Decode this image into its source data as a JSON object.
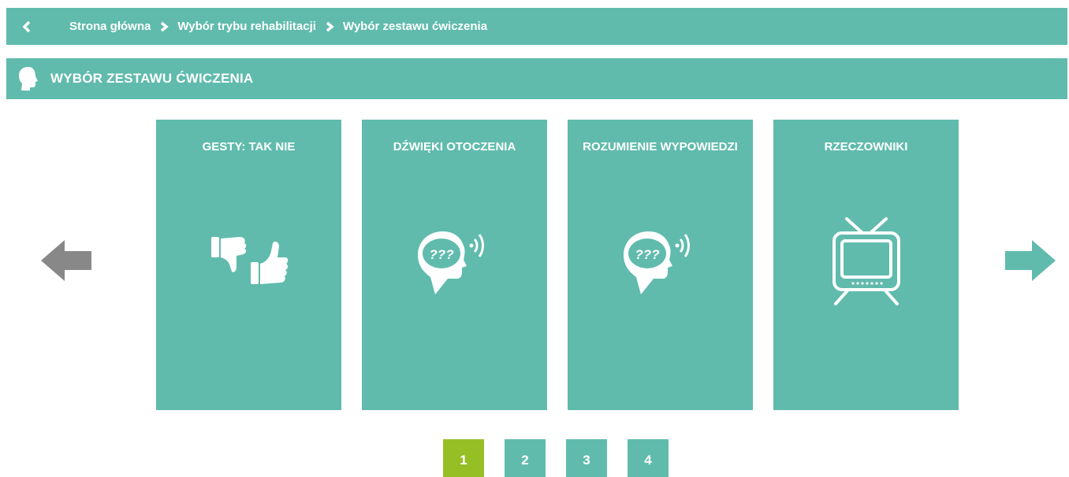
{
  "breadcrumb": {
    "back_icon": "chevron-left-icon",
    "items": [
      {
        "label": "Strona główna"
      },
      {
        "label": "Wybór trybu rehabilitacji"
      },
      {
        "label": "Wybór zestawu ćwiczenia"
      }
    ]
  },
  "header": {
    "icon": "head-silhouette-icon",
    "title": "WYBÓR ZESTAWU ĆWICZENIA"
  },
  "cards": [
    {
      "title": "GESTY: TAK NIE",
      "icon": "thumbs-down-up-icon"
    },
    {
      "title": "DŹWIĘKI OTOCZENIA",
      "icon": "head-sound-icon"
    },
    {
      "title": "ROZUMIENIE WYPOWIEDZI",
      "icon": "head-sound-icon"
    },
    {
      "title": "RZECZOWNIKI",
      "icon": "tv-icon"
    }
  ],
  "navigation": {
    "prev_icon": "arrow-left-icon",
    "next_icon": "arrow-right-icon"
  },
  "pagination": {
    "pages": [
      "1",
      "2",
      "3",
      "4"
    ],
    "active_page": "1"
  },
  "colors": {
    "primary": "#60bbad",
    "active_page": "#96bf26",
    "prev_arrow": "#888888",
    "next_arrow": "#60bbad",
    "text": "#ffffff"
  }
}
